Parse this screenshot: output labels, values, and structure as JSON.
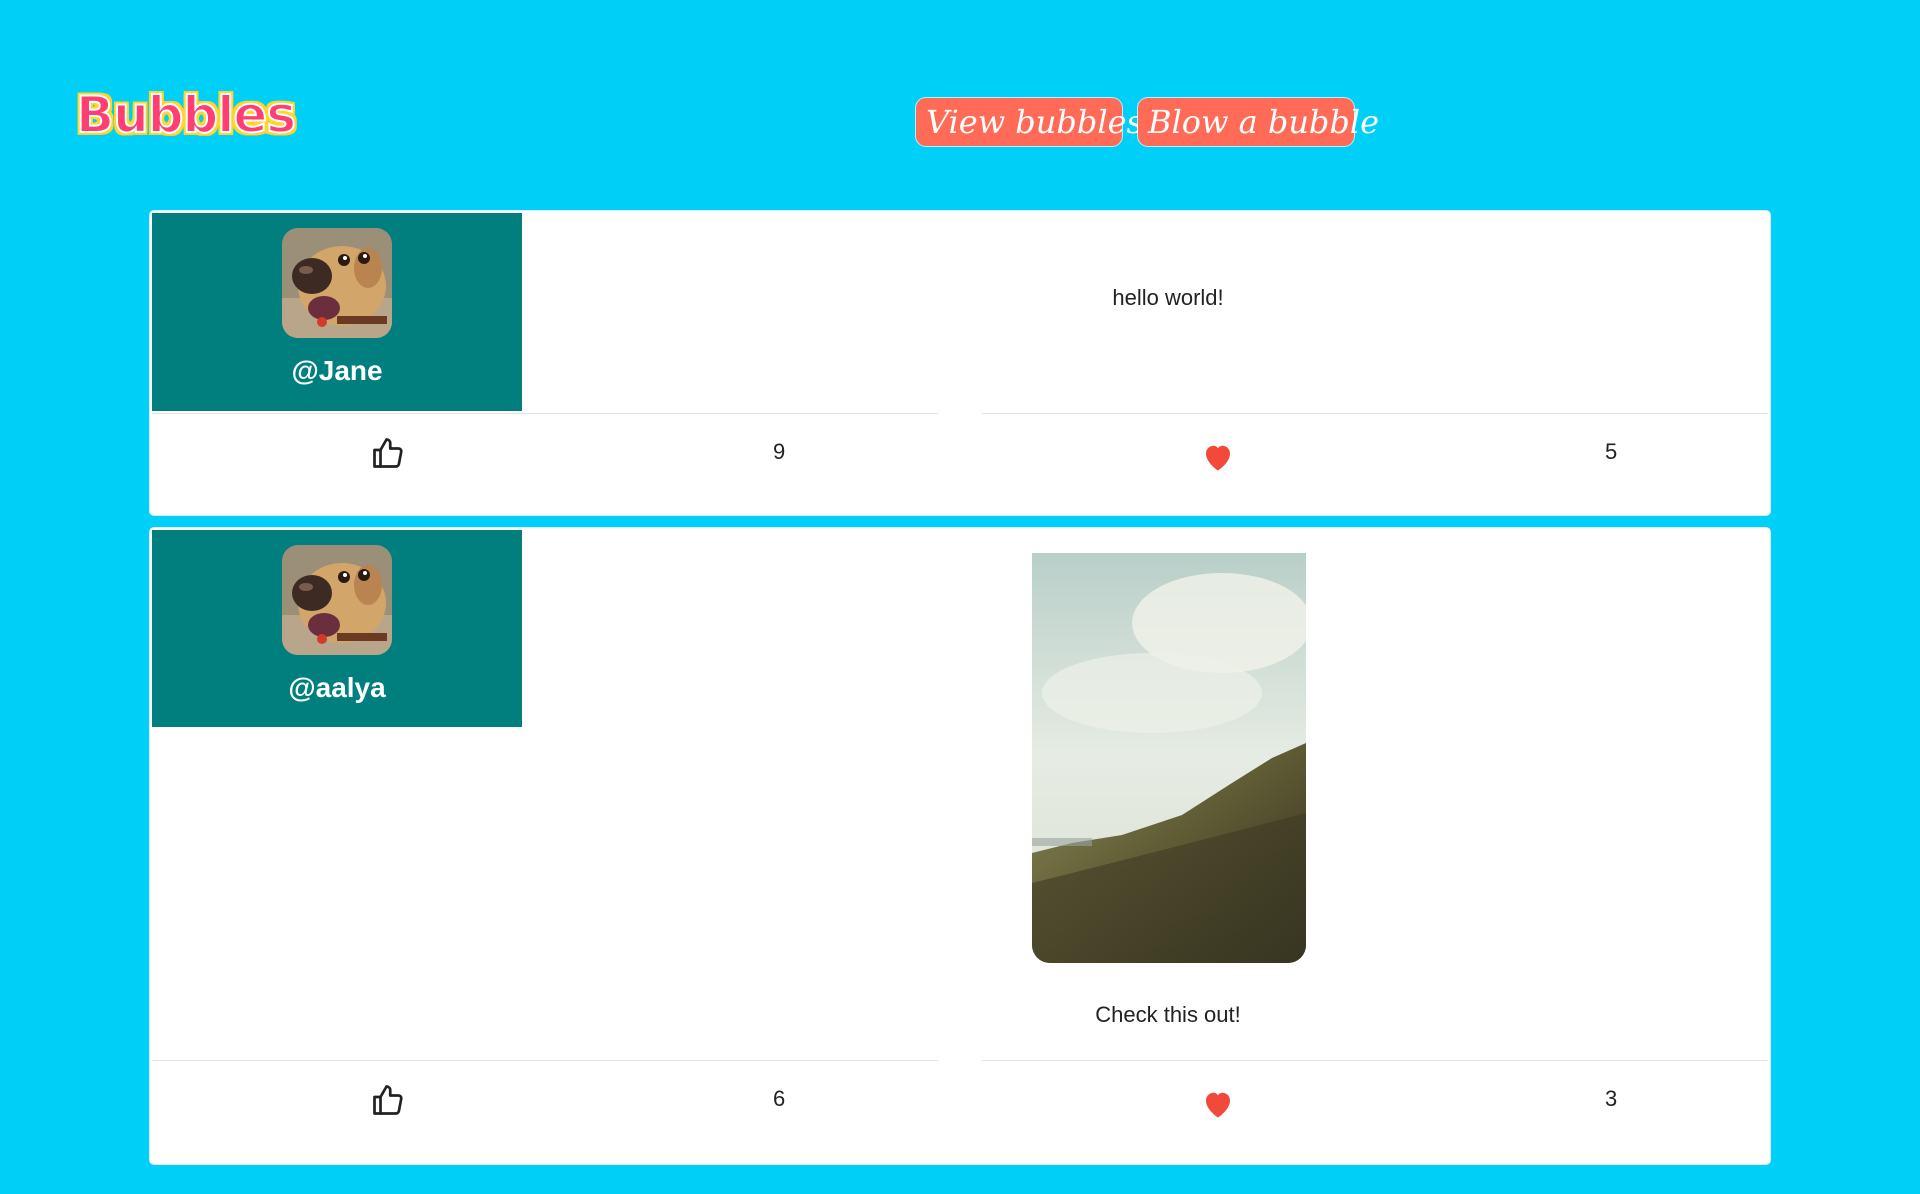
{
  "brand": {
    "logo_text": "Bubbles"
  },
  "nav": {
    "view_label": "View bubbles",
    "blow_label": "Blow a bubble"
  },
  "posts": [
    {
      "username": "@Jane",
      "text": "hello world!",
      "likes": "9",
      "hearts": "5",
      "avatar_icon": "dog-avatar-icon",
      "like_icon": "thumbs-up-icon",
      "heart_icon": "heart-icon"
    },
    {
      "username": "@aalya",
      "text": "Check this out!",
      "likes": "6",
      "hearts": "3",
      "avatar_icon": "dog-avatar-icon",
      "like_icon": "thumbs-up-icon",
      "heart_icon": "heart-icon",
      "image": "hillside-landscape-photo"
    }
  ],
  "colors": {
    "background": "#00d0f8",
    "profile_panel": "#007f7e",
    "button": "#ff6b57",
    "heart": "#f24a3a"
  }
}
